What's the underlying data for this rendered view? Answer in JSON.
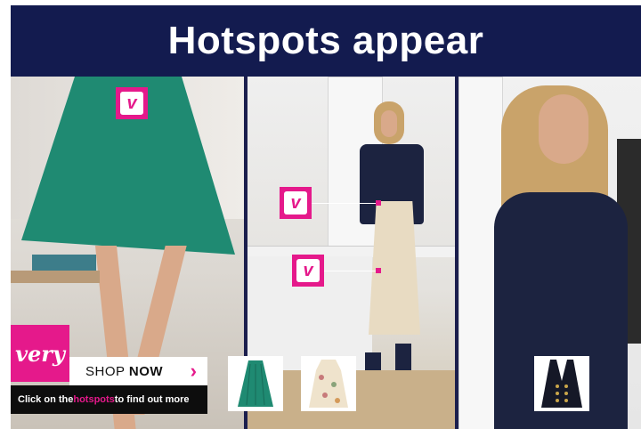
{
  "header": {
    "title": "Hotspots appear"
  },
  "brand": {
    "logo_text": "very",
    "accent_color": "#e5198b",
    "navy_color": "#131b4f"
  },
  "hotspots": [
    {
      "label": "v",
      "icon": "very-v-icon"
    },
    {
      "label": "v",
      "icon": "very-v-icon"
    },
    {
      "label": "v",
      "icon": "very-v-icon"
    }
  ],
  "cta": {
    "shop_prefix": "SHOP ",
    "shop_bold": "NOW",
    "arrow": "›",
    "caption_before": "Click on the ",
    "caption_highlight": "hotspots",
    "caption_after": " to find out more"
  },
  "products": [
    {
      "name": "green-pleated-skirt",
      "icon": "skirt-icon"
    },
    {
      "name": "floral-dress",
      "icon": "dress-icon"
    },
    {
      "name": "navy-military-jacket",
      "icon": "jacket-icon"
    }
  ]
}
